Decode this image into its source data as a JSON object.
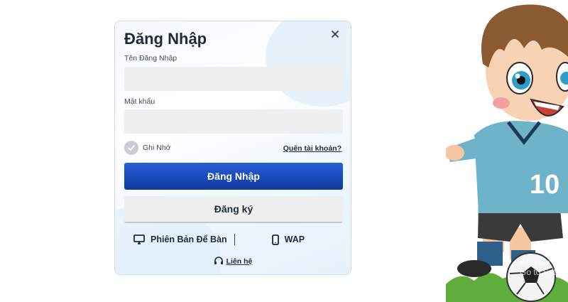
{
  "login": {
    "title": "Đăng Nhập",
    "username_label": "Tên Đăng Nhập",
    "username_value": "",
    "password_label": "Mật khẩu",
    "password_value": "",
    "remember_label": "Ghi Nhớ",
    "forgot_link": "Quên tài khoản?",
    "login_button": "Đăng Nhập",
    "register_button": "Đăng ký",
    "desktop_version": "Phiên Bản Để Bàn",
    "wap_version": "WAP",
    "contact_link": "Liên hệ"
  },
  "mascot": {
    "jersey_number": "10"
  },
  "watermark": {
    "line1": "Activate",
    "line2": "Go to Settin"
  },
  "colors": {
    "primary_button": "#1a4fc4",
    "jersey": "#6fb3c9"
  }
}
